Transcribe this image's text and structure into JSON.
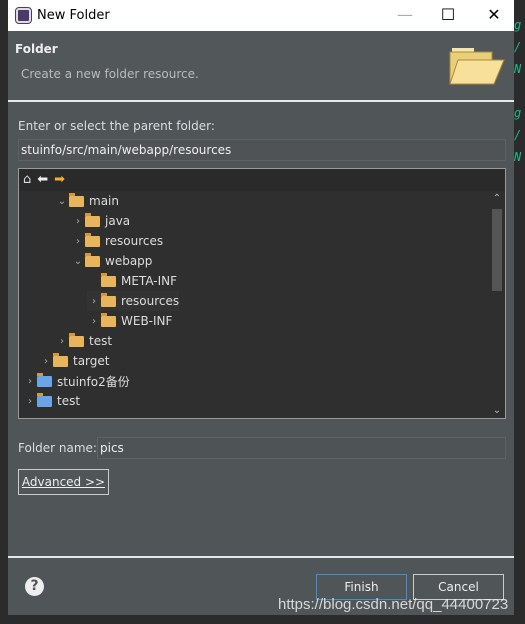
{
  "window": {
    "title": "New Folder",
    "minimize": "—",
    "maximize": "☐",
    "close": "✕"
  },
  "header": {
    "title": "Folder",
    "subtitle": "Create a new folder resource."
  },
  "parent": {
    "label": "Enter or select the parent folder:",
    "value": "stuinfo/src/main/webapp/resources"
  },
  "tree": {
    "items": [
      {
        "label": "main",
        "depth": 2,
        "expanded": true,
        "type": "folder"
      },
      {
        "label": "java",
        "depth": 3,
        "expanded": false,
        "type": "folder"
      },
      {
        "label": "resources",
        "depth": 3,
        "expanded": false,
        "type": "folder"
      },
      {
        "label": "webapp",
        "depth": 3,
        "expanded": true,
        "type": "folder"
      },
      {
        "label": "META-INF",
        "depth": 4,
        "leaf": true,
        "type": "folder"
      },
      {
        "label": "resources",
        "depth": 4,
        "expanded": false,
        "type": "folder",
        "selected": true
      },
      {
        "label": "WEB-INF",
        "depth": 4,
        "expanded": false,
        "type": "folder"
      },
      {
        "label": "test",
        "depth": 2,
        "expanded": false,
        "type": "folder"
      },
      {
        "label": "target",
        "depth": 1,
        "expanded": false,
        "type": "folder"
      },
      {
        "label": "stuinfo2备份",
        "depth": 0,
        "expanded": false,
        "type": "project"
      },
      {
        "label": "test",
        "depth": 0,
        "expanded": false,
        "type": "project"
      }
    ]
  },
  "folder_name": {
    "label": "Folder name:",
    "value": "pics"
  },
  "advanced": "Advanced >>",
  "buttons": {
    "finish": "Finish",
    "cancel": "Cancel"
  },
  "watermark": "https://blog.csdn.net/qq_44400723"
}
